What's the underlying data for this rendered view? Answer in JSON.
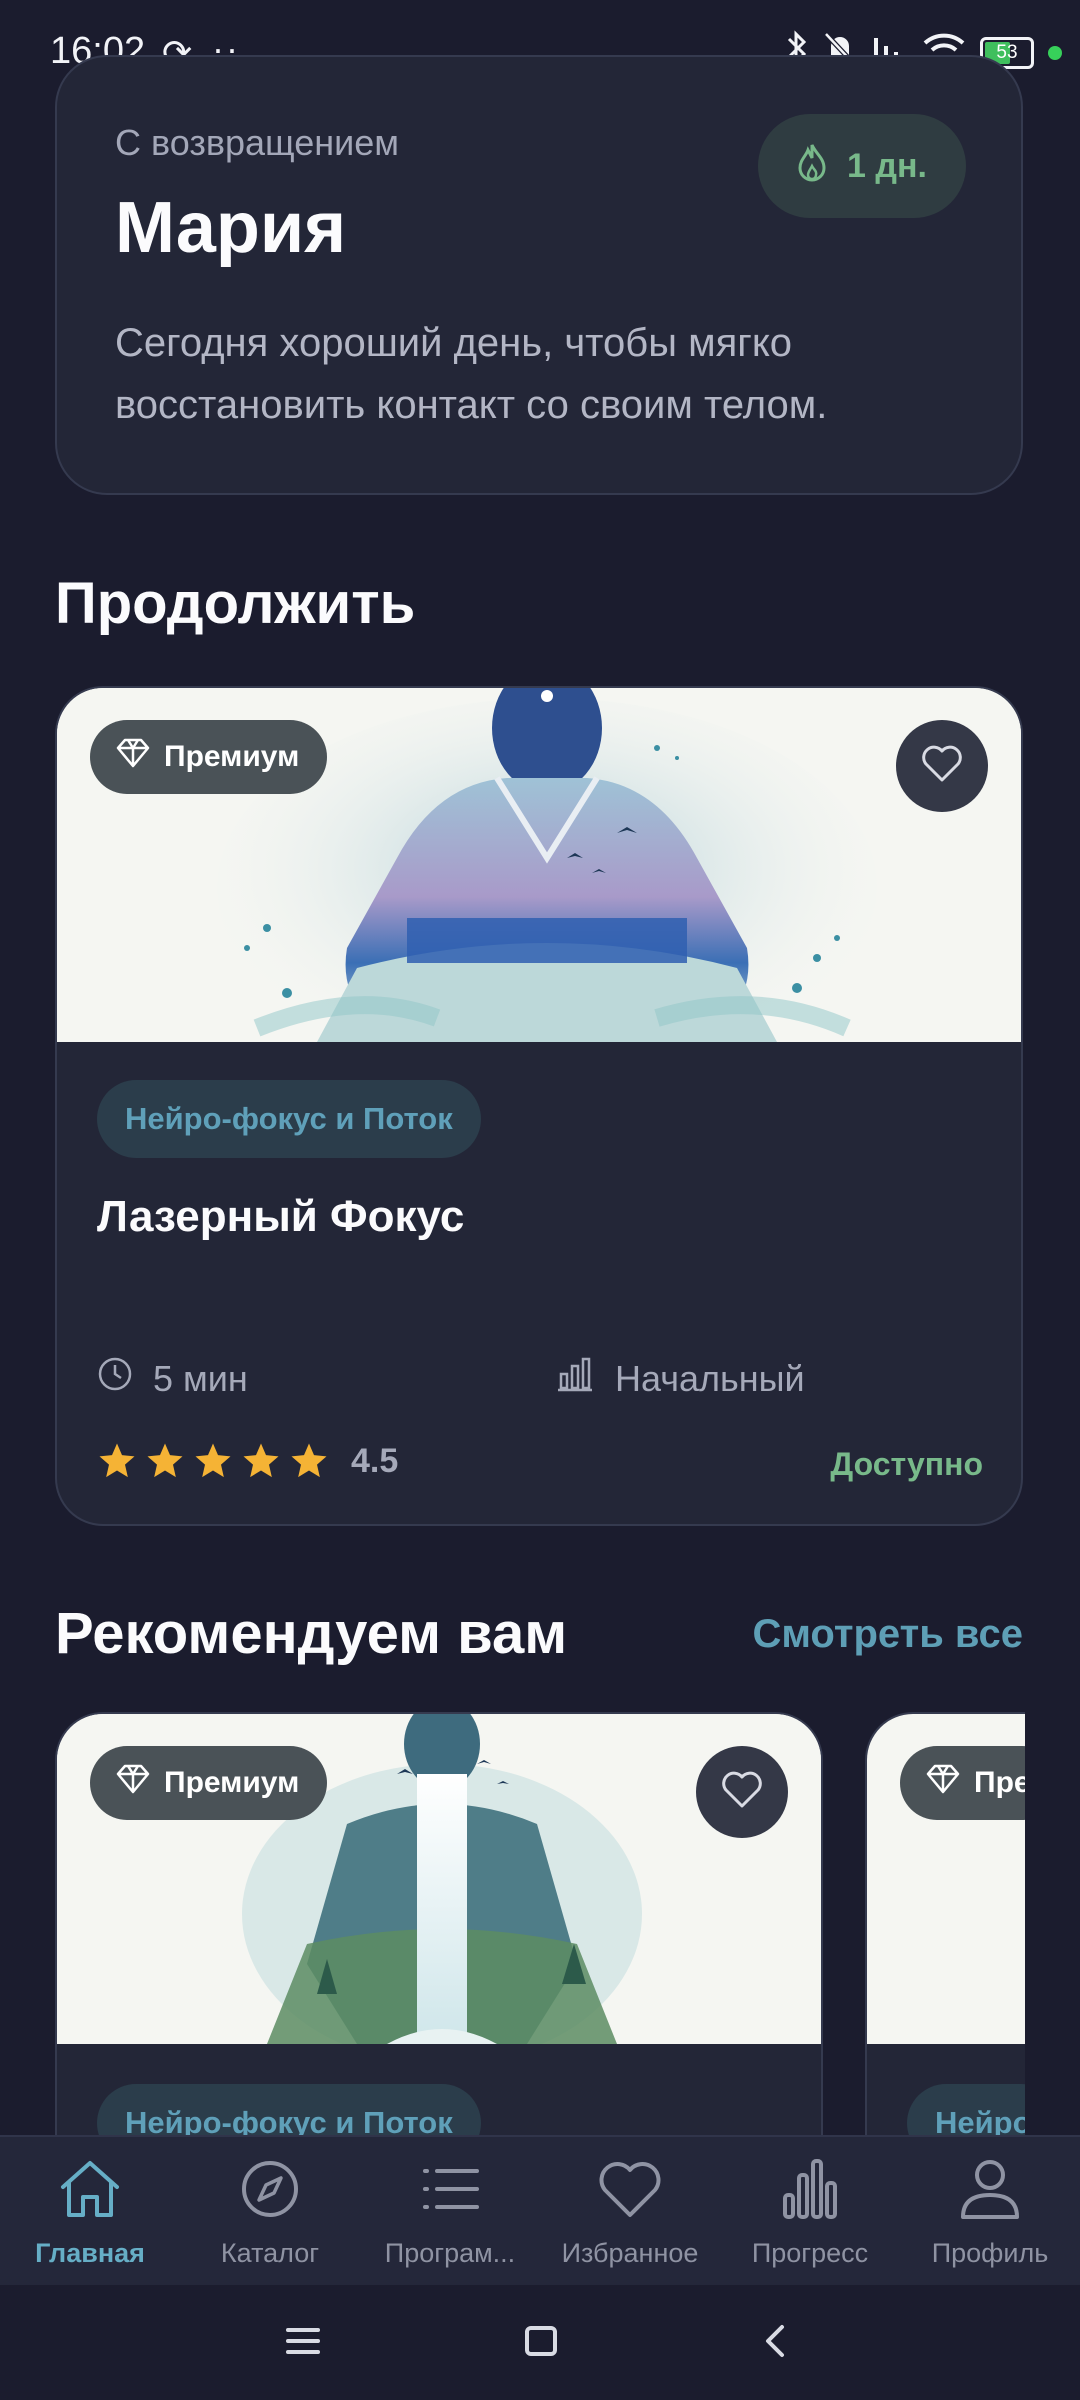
{
  "status_bar": {
    "time": "16:02",
    "battery": "53"
  },
  "welcome": {
    "subtitle": "С возвращением",
    "name": "Мария",
    "message": "Сегодня хороший день, чтобы мягко восстановить контакт со своим телом.",
    "streak": "1 дн."
  },
  "continue": {
    "heading": "Продолжить",
    "card": {
      "badge": "Премиум",
      "category": "Нейро-фокус и Поток",
      "title": "Лазерный Фокус",
      "duration": "5 мин",
      "level": "Начальный",
      "rating_value": 4.5,
      "rating": "4.5",
      "status": "Доступно"
    }
  },
  "recommended": {
    "heading": "Рекомендуем вам",
    "see_all": "Смотреть все",
    "cards": [
      {
        "badge": "Премиум",
        "category": "Нейро-фокус и Поток"
      },
      {
        "badge": "Пре",
        "category": "Нейро"
      }
    ]
  },
  "nav": {
    "items": [
      {
        "label": "Главная",
        "icon": "home-icon",
        "active": true
      },
      {
        "label": "Каталог",
        "icon": "compass-icon",
        "active": false
      },
      {
        "label": "Програм...",
        "icon": "list-icon",
        "active": false
      },
      {
        "label": "Избранное",
        "icon": "heart-icon",
        "active": false
      },
      {
        "label": "Прогресс",
        "icon": "bar-chart-icon",
        "active": false
      },
      {
        "label": "Профиль",
        "icon": "user-icon",
        "active": false
      }
    ]
  },
  "colors": {
    "background": "#1b1c2e",
    "card": "#232637",
    "accent": "#66aec6",
    "success": "#78b98a",
    "star": "#f5b335"
  }
}
